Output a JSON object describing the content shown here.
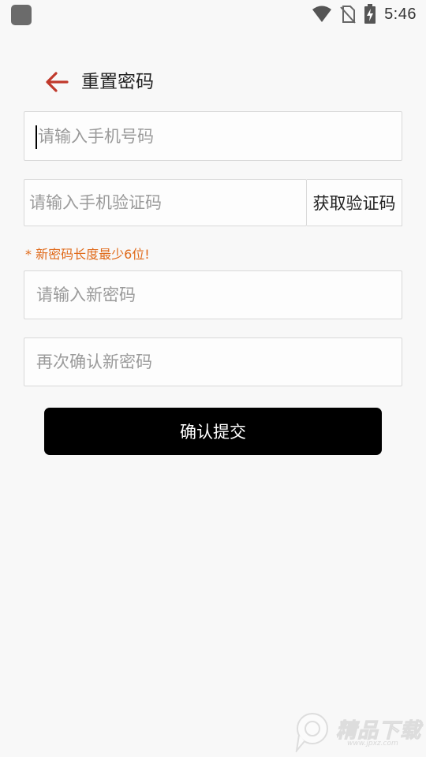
{
  "status_bar": {
    "time": "5:46",
    "icons": [
      "app-notification-icon",
      "wifi-icon",
      "no-sim-icon",
      "battery-charging-icon"
    ]
  },
  "header": {
    "back_icon": "arrow-left-icon",
    "title": "重置密码"
  },
  "form": {
    "phone_placeholder": "请输入手机号码",
    "phone_value": "",
    "code_placeholder": "请输入手机验证码",
    "code_value": "",
    "get_code_label": "获取验证码",
    "hint": "* 新密码长度最少6位!",
    "new_password_placeholder": "请输入新密码",
    "new_password_value": "",
    "confirm_password_placeholder": "再次确认新密码",
    "confirm_password_value": "",
    "submit_label": "确认提交"
  },
  "watermark": {
    "text": "精品下载",
    "url": "www.jpxz.com"
  },
  "colors": {
    "background": "#f8f8f8",
    "back_arrow": "#c0392b",
    "hint": "#e06a1a",
    "submit_bg": "#000000",
    "submit_text": "#ffffff",
    "field_border": "#d9d9d9",
    "placeholder": "#9a9a9a"
  }
}
